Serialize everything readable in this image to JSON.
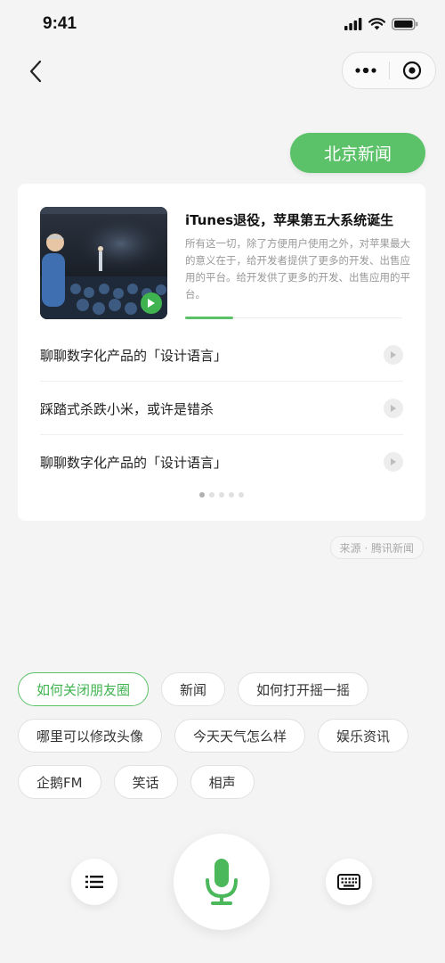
{
  "status_bar": {
    "time": "9:41"
  },
  "icons": {
    "signal": "signal-icon",
    "wifi": "wifi-icon",
    "battery": "battery-icon",
    "back": "chevron-left-icon",
    "more": "more-dots-icon",
    "target": "target-icon",
    "play": "play-icon",
    "list": "list-icon",
    "mic": "microphone-icon",
    "keyboard": "keyboard-icon"
  },
  "colors": {
    "accent": "#5cc26a",
    "background": "#f4f4f4"
  },
  "header": {
    "pill_label": "北京新闻"
  },
  "card": {
    "feature": {
      "title": "iTunes退役，苹果第五大系统诞生",
      "description": "所有这一切，除了方便用户使用之外，对苹果最大的意义在于，给开发者提供了更多的开发、出售应用的平台。给开发供了更多的开发、出售应用的平台。",
      "progress": 0.22
    },
    "items": [
      {
        "title": "聊聊数字化产品的「设计语言」"
      },
      {
        "title": "踩踏式杀跌小米，或许是错杀"
      },
      {
        "title": "聊聊数字化产品的「设计语言」"
      }
    ],
    "pagination": {
      "total": 5,
      "current": 1
    }
  },
  "source": "来源 · 腾讯新闻",
  "suggestions": [
    {
      "label": "如何关闭朋友圈",
      "active": true
    },
    {
      "label": "新闻",
      "active": false
    },
    {
      "label": "如何打开摇一摇",
      "active": false
    },
    {
      "label": "哪里可以修改头像",
      "active": false
    },
    {
      "label": "今天天气怎么样",
      "active": false
    },
    {
      "label": "娱乐资讯",
      "active": false
    },
    {
      "label": "企鹅FM",
      "active": false
    },
    {
      "label": "笑话",
      "active": false
    },
    {
      "label": "相声",
      "active": false
    }
  ]
}
